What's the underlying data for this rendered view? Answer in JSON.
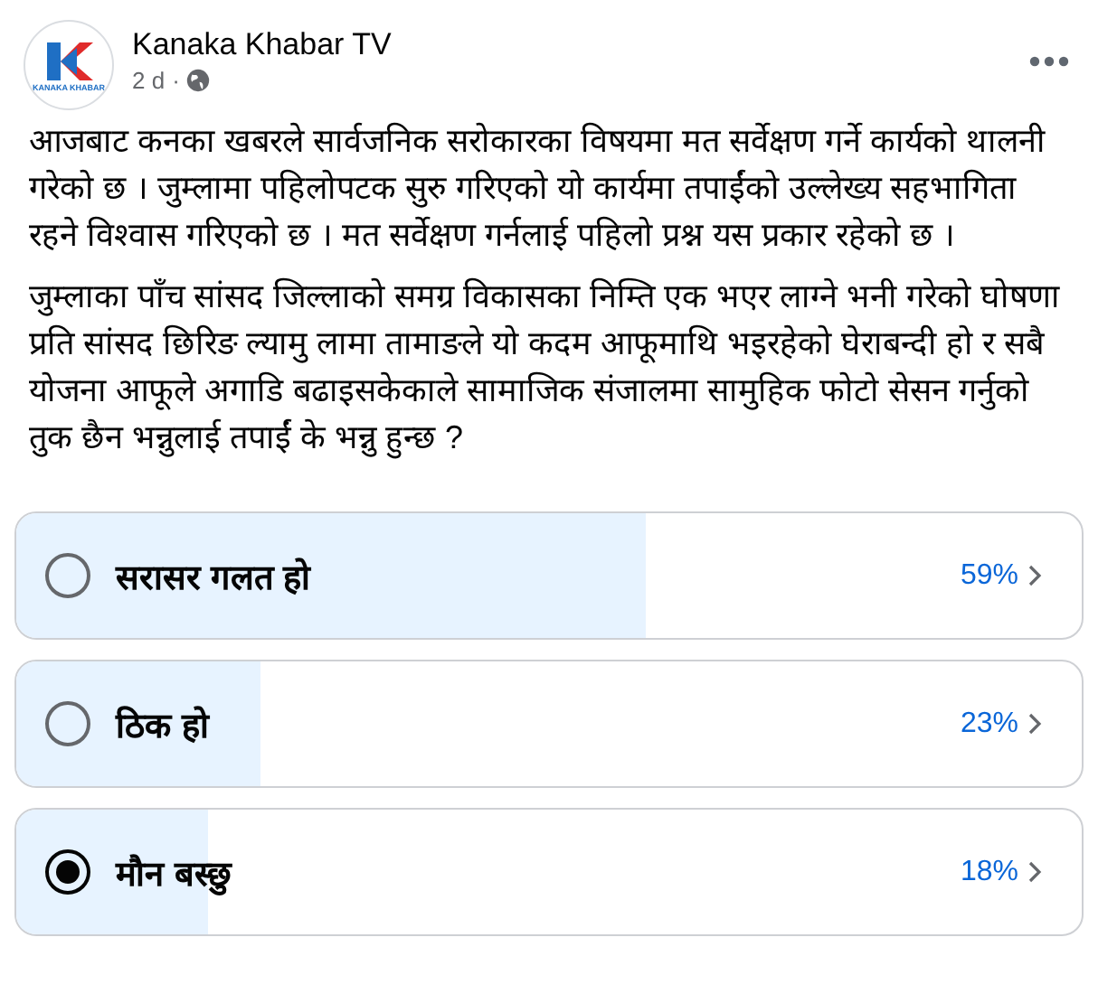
{
  "post": {
    "author": "Kanaka Khabar TV",
    "logo_text": "KANAKA KHABAR",
    "time": "2 d",
    "separator": "·",
    "paragraphs": [
      "आजबाट कनका खबरले सार्वजनिक सरोकारका विषयमा मत सर्वेक्षण गर्ने कार्यको थालनी गरेको छ । जुम्लामा पहिलोपटक सुरु गरिएको यो कार्यमा तपाईंको उल्लेख्य सहभागिता रहने विश्वास गरिएको छ । मत सर्वेक्षण गर्नलाई पहिलो प्रश्न यस प्रकार रहेको छ ।",
      "जुम्लाका पाँच सांसद जिल्लाको समग्र विकासका निम्ति एक भएर लाग्ने भनी गरेको घोषणा प्रति सांसद छिरिङ ल्यामु लामा तामाङले यो कदम आफूमाथि भइरहेको घेराबन्दी हो र सबै योजना आफूले अगाडि बढाइसकेकाले सामाजिक संजालमा सामुहिक फोटो सेसन गर्नुको तुक छैन भन्नुलाई तपाईं के भन्नु हुन्छ ?"
    ]
  },
  "poll": {
    "options": [
      {
        "label": "सरासर गलत हो",
        "percent": "59%",
        "level": 0.59,
        "selected": false
      },
      {
        "label": "ठिक हो",
        "percent": "23%",
        "level": 0.23,
        "selected": false
      },
      {
        "label": "मौन बस्छु",
        "percent": "18%",
        "level": 0.18,
        "selected": true
      }
    ]
  }
}
